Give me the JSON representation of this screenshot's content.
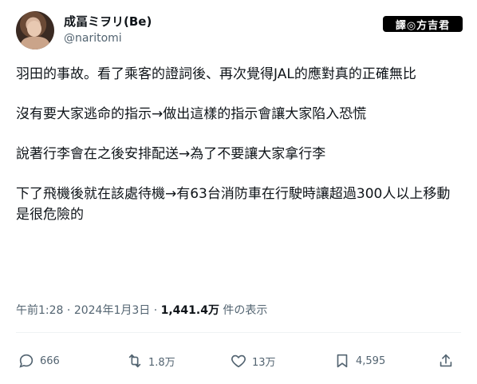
{
  "author": {
    "display_name": "成畐ミヲリ(Be)",
    "handle": "@naritomi"
  },
  "watermark": "譯◎方吉君",
  "tweet": {
    "paragraphs": [
      "羽田的事故。看了乘客的證詞後、再次覺得JAL的應對真的正確無比",
      "沒有要大家逃命的指示→做出這樣的指示會讓大家陷入恐慌",
      "說著行李會在之後安排配送→為了不要讓大家拿行李",
      "下了飛機後就在該處待機→有63台消防車在行駛時讓超過300人以上移動是很危險的"
    ]
  },
  "meta": {
    "time": "午前1:28",
    "sep1": " · ",
    "date": "2024年1月3日",
    "sep2": " · ",
    "views": "1,441.4万",
    "views_label": " 件の表示"
  },
  "actions": {
    "reply": {
      "icon": "reply-icon",
      "count": "666"
    },
    "retweet": {
      "icon": "retweet-icon",
      "count": "1.8万"
    },
    "like": {
      "icon": "heart-icon",
      "count": "13万"
    },
    "bookmark": {
      "icon": "bookmark-icon",
      "count": "4,595"
    },
    "share": {
      "icon": "share-icon"
    }
  },
  "colors": {
    "text": "#0f1419",
    "secondary": "#536471",
    "divider": "#eff3f4"
  }
}
